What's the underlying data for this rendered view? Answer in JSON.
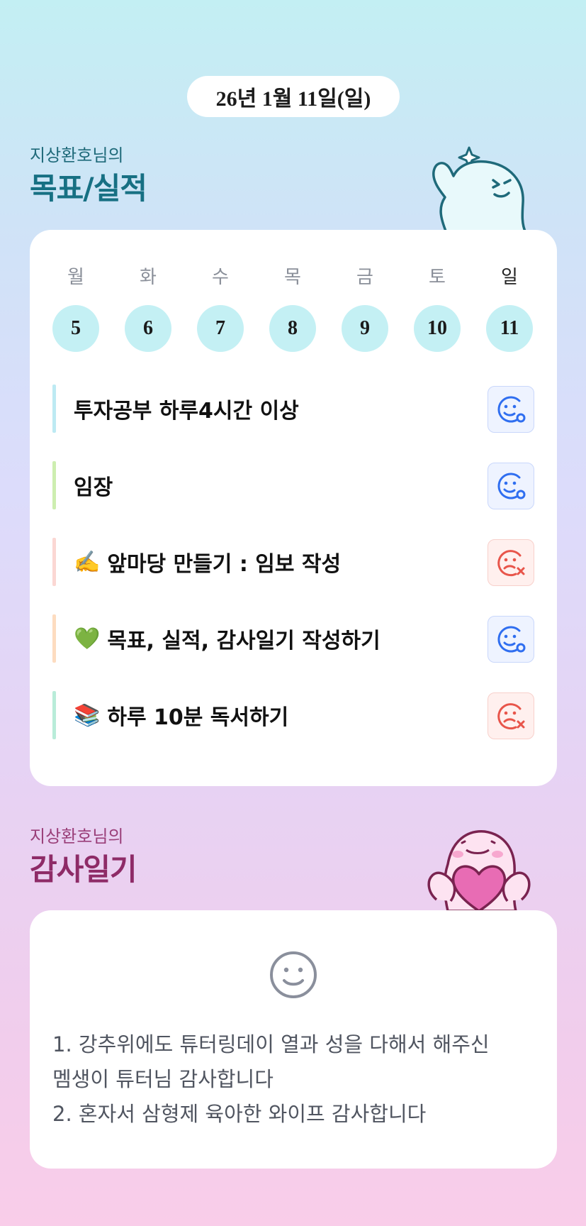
{
  "date_label": "26년 1월 11일(일)",
  "goals_section": {
    "subtitle": "지상환호님의",
    "title": "목표/실적"
  },
  "week": [
    {
      "day": "월",
      "date": "5"
    },
    {
      "day": "화",
      "date": "6"
    },
    {
      "day": "수",
      "date": "7"
    },
    {
      "day": "목",
      "date": "8"
    },
    {
      "day": "금",
      "date": "9"
    },
    {
      "day": "토",
      "date": "10"
    },
    {
      "day": "일",
      "date": "11"
    }
  ],
  "goals": [
    {
      "emoji": "",
      "text": "투자공부 하루4시간 이상",
      "status": "achieved",
      "bar_color": "#bdeaf3"
    },
    {
      "emoji": "",
      "text": "임장",
      "status": "achieved",
      "bar_color": "#cdeeb0"
    },
    {
      "emoji": "✍️",
      "text": "앞마당 만들기 : 임보 작성",
      "status": "missed",
      "bar_color": "#fbd7d3"
    },
    {
      "emoji": "💚",
      "text": "목표, 실적, 감사일기 작성하기",
      "status": "achieved",
      "bar_color": "#fddcc0"
    },
    {
      "emoji": "📚",
      "text": "하루 10분 독서하기",
      "status": "missed",
      "bar_color": "#b9ecd9"
    }
  ],
  "gratitude_section": {
    "subtitle": "지상환호님의",
    "title": "감사일기",
    "icon": "smile-icon",
    "lines": [
      "1. 강추위에도 튜터링데이 열과 성을 다해서 해주신",
      "멤생이 튜터님 감사합니다",
      "2. 혼자서 삼형제 육아한 와이프 감사합니다"
    ]
  },
  "colors": {
    "status_ok": "#2f6ef0",
    "status_fail": "#e8554a",
    "date_circle": "#c4f0f4"
  }
}
